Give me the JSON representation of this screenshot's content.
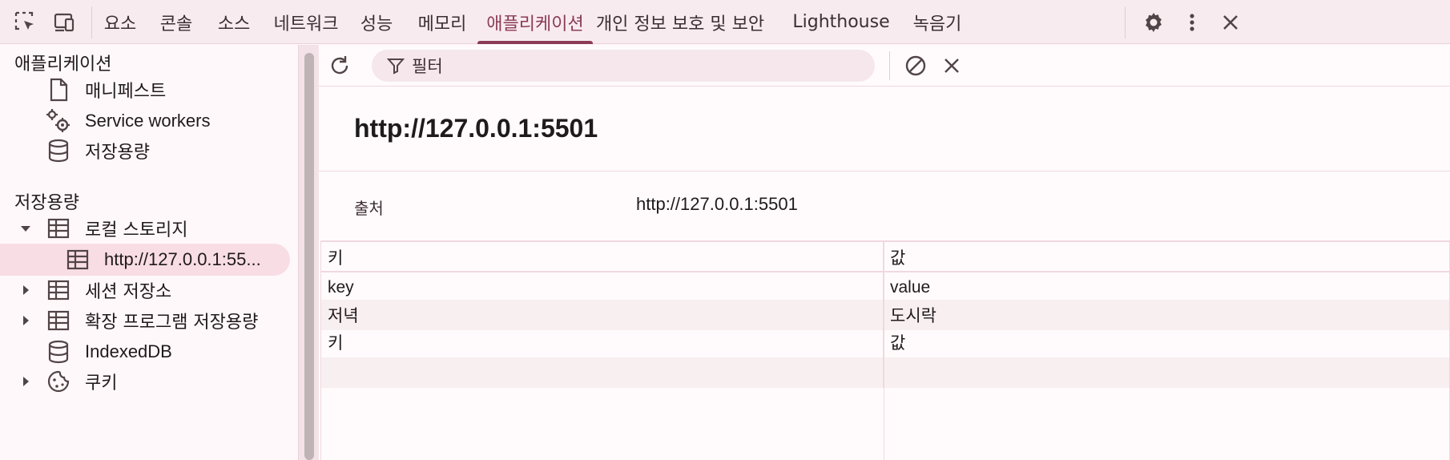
{
  "toolbar": {
    "tabs": [
      {
        "label": "요소"
      },
      {
        "label": "콘솔"
      },
      {
        "label": "소스"
      },
      {
        "label": "네트워크"
      },
      {
        "label": "성능"
      },
      {
        "label": "메모리"
      },
      {
        "label": "애플리케이션",
        "active": true
      },
      {
        "label": "개인 정보 보호 및 보안"
      },
      {
        "label": "Lighthouse"
      },
      {
        "label": "녹음기"
      }
    ],
    "icons": [
      "select-element-icon",
      "device-toolbar-icon",
      "settings-gear-icon",
      "more-vert-icon",
      "close-icon"
    ]
  },
  "sidebar": {
    "section_app": "애플리케이션",
    "app_items": [
      {
        "label": "매니페스트",
        "icon": "document-icon"
      },
      {
        "label": "Service workers",
        "icon": "gears-icon"
      },
      {
        "label": "저장용량",
        "icon": "database-icon"
      }
    ],
    "section_storage": "저장용량",
    "storage_items": [
      {
        "label": "로컬 스토리지",
        "icon": "table-icon",
        "expanded": true
      },
      {
        "label": "http://127.0.0.1:55...",
        "icon": "table-icon",
        "selected": true
      },
      {
        "label": "세션 저장소",
        "icon": "table-icon"
      },
      {
        "label": "확장 프로그램 저장용량",
        "icon": "table-icon"
      },
      {
        "label": "IndexedDB",
        "icon": "database-icon"
      },
      {
        "label": "쿠키",
        "icon": "cookie-icon"
      }
    ]
  },
  "main": {
    "filter": {
      "placeholder": "필터"
    },
    "origin_title": "http://127.0.0.1:5501",
    "origin_label": "출처",
    "origin_value": "http://127.0.0.1:5501",
    "table": {
      "columns": [
        "키",
        "값"
      ],
      "rows": [
        [
          "key",
          "value"
        ],
        [
          "저녁",
          "도시락"
        ],
        [
          "키",
          "값"
        ]
      ]
    }
  },
  "colors": {
    "accent": "#8b3b56",
    "toolbar_bg": "#f8ebef",
    "selected_bg": "#f8dde4"
  }
}
